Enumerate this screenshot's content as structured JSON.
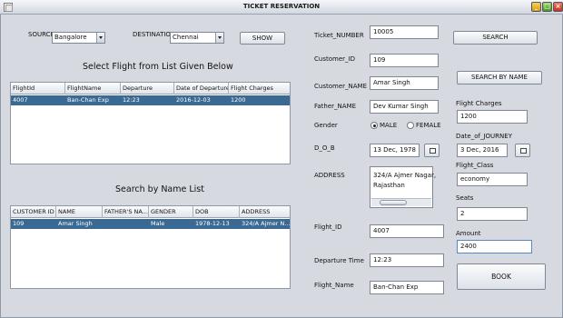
{
  "window": {
    "title": "TICKET RESERVATION"
  },
  "search_panel": {
    "source_label": "SOURCE",
    "source_value": "Bangalore",
    "destination_label": "DESTINATION",
    "destination_value": "Chennai",
    "show_button": "SHOW"
  },
  "flight_list": {
    "heading": "Select Flight from List Given Below",
    "columns": [
      "FlightId",
      "FlightName",
      "Departure",
      "Date of Departure",
      "Flight Charges"
    ],
    "rows": [
      {
        "FlightId": "4007",
        "FlightName": "Ban-Chan Exp",
        "Departure": "12:23",
        "Date of Departure": "2016-12-03",
        "Flight Charges": "1200"
      }
    ]
  },
  "name_list": {
    "heading": "Search by Name List",
    "columns": [
      "CUSTOMER ID",
      "NAME",
      "FATHER'S NA...",
      "GENDER",
      "DOB",
      "ADDRESS"
    ],
    "rows": [
      {
        "CUSTOMER ID": "109",
        "NAME": "Amar Singh",
        "FATHER'S NA...": "Dev Kumar Sin...",
        "GENDER": "Male",
        "DOB": "1978-12-13",
        "ADDRESS": "324/A Ajmer N..."
      }
    ]
  },
  "form": {
    "ticket_number_label": "Ticket_NUMBER",
    "ticket_number": "10005",
    "customer_id_label": "Customer_ID",
    "customer_id": "109",
    "customer_name_label": "Customer_NAME",
    "customer_name": "Amar Singh",
    "father_name_label": "Father_NAME",
    "father_name": "Dev Kumar Singh",
    "gender_label": "Gender",
    "gender_male": "MALE",
    "gender_female": "FEMALE",
    "dob_label": "D_O_B",
    "dob": "13 Dec, 1978",
    "address_label": "ADDRESS",
    "address_line1": "324/A Ajmer Nagar,",
    "address_line2": "Rajasthan",
    "flight_id_label": "Flight_ID",
    "flight_id": "4007",
    "departure_time_label": "Departure Time",
    "departure_time": "12:23",
    "flight_name_label": "Flight_Name",
    "flight_name": "Ban-Chan Exp"
  },
  "right_panel": {
    "search_button": "SEARCH",
    "search_by_name_button": "SEARCH BY NAME",
    "flight_charges_label": "Flight Charges",
    "flight_charges": "1200",
    "date_of_journey_label": "Date_of_JOURNEY",
    "date_of_journey": "3 Dec, 2016",
    "flight_class_label": "Flight_Class",
    "flight_class": "economy",
    "seats_label": "Seats",
    "seats": "2",
    "amount_label": "Amount",
    "amount": "2400",
    "book_button": "BOOK"
  }
}
